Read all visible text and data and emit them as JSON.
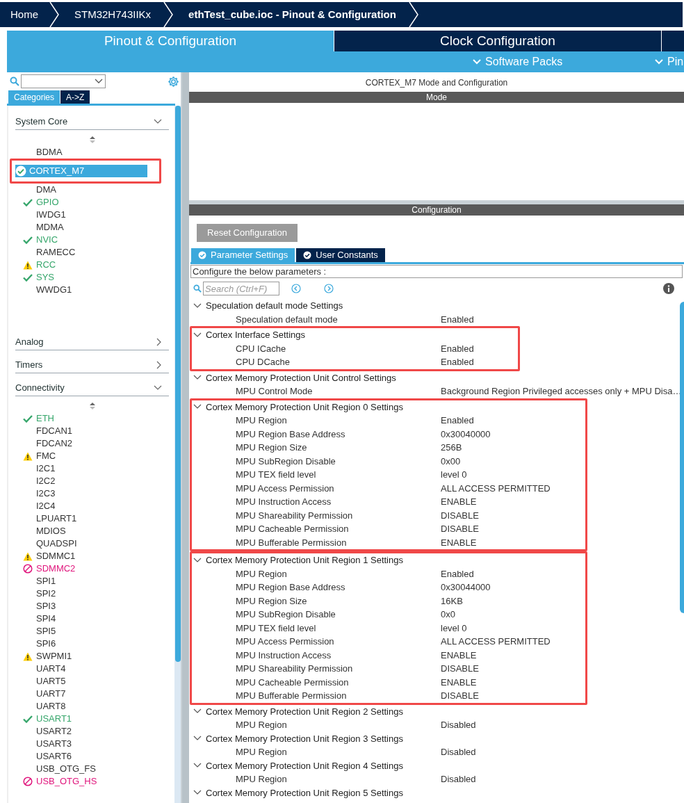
{
  "breadcrumbs": [
    "Home",
    "STM32H743IIKx",
    "ethTest_cube.ioc - Pinout & Configuration"
  ],
  "main_tabs": [
    {
      "label": "Pinout & Configuration",
      "selected": true
    },
    {
      "label": "Clock Configuration",
      "selected": false
    }
  ],
  "sub_menu": [
    "Software Packs",
    "Pin"
  ],
  "sidebar": {
    "tabs": [
      {
        "label": "Categories",
        "selected": true
      },
      {
        "label": "A->Z",
        "selected": false
      }
    ],
    "categories": [
      {
        "label": "System Core",
        "expanded": true,
        "items": [
          {
            "label": "BDMA",
            "kind": "plain",
            "configured": false,
            "selected": false
          },
          {
            "label": "CORTEX_M7",
            "kind": "check",
            "configured": true,
            "selected": true,
            "highlighted": true
          },
          {
            "label": "DMA",
            "kind": "plain",
            "configured": false,
            "selected": false
          },
          {
            "label": "GPIO",
            "kind": "check",
            "configured": true,
            "selected": false
          },
          {
            "label": "IWDG1",
            "kind": "plain",
            "configured": false,
            "selected": false
          },
          {
            "label": "MDMA",
            "kind": "plain",
            "configured": false,
            "selected": false
          },
          {
            "label": "NVIC",
            "kind": "check",
            "configured": true,
            "selected": false
          },
          {
            "label": "RAMECC",
            "kind": "plain",
            "configured": false,
            "selected": false
          },
          {
            "label": "RCC",
            "kind": "warning",
            "configured": true,
            "selected": false
          },
          {
            "label": "SYS",
            "kind": "check",
            "configured": true,
            "selected": false
          },
          {
            "label": "WWDG1",
            "kind": "plain",
            "configured": false,
            "selected": false
          }
        ]
      },
      {
        "label": "Analog",
        "expanded": false
      },
      {
        "label": "Timers",
        "expanded": false
      },
      {
        "label": "Connectivity",
        "expanded": true,
        "items": [
          {
            "label": "ETH",
            "kind": "check",
            "configured": true,
            "selected": false
          },
          {
            "label": "FDCAN1",
            "kind": "plain",
            "configured": false,
            "selected": false
          },
          {
            "label": "FDCAN2",
            "kind": "plain",
            "configured": false,
            "selected": false
          },
          {
            "label": "FMC",
            "kind": "warning",
            "configured": false,
            "selected": false
          },
          {
            "label": "I2C1",
            "kind": "plain",
            "configured": false,
            "selected": false
          },
          {
            "label": "I2C2",
            "kind": "plain",
            "configured": false,
            "selected": false
          },
          {
            "label": "I2C3",
            "kind": "plain",
            "configured": false,
            "selected": false
          },
          {
            "label": "I2C4",
            "kind": "plain",
            "configured": false,
            "selected": false
          },
          {
            "label": "LPUART1",
            "kind": "plain",
            "configured": false,
            "selected": false
          },
          {
            "label": "MDIOS",
            "kind": "plain",
            "configured": false,
            "selected": false
          },
          {
            "label": "QUADSPI",
            "kind": "plain",
            "configured": false,
            "selected": false
          },
          {
            "label": "SDMMC1",
            "kind": "warning",
            "configured": false,
            "selected": false
          },
          {
            "label": "SDMMC2",
            "kind": "blocked",
            "configured": false,
            "selected": false
          },
          {
            "label": "SPI1",
            "kind": "plain",
            "configured": false,
            "selected": false
          },
          {
            "label": "SPI2",
            "kind": "plain",
            "configured": false,
            "selected": false
          },
          {
            "label": "SPI3",
            "kind": "plain",
            "configured": false,
            "selected": false
          },
          {
            "label": "SPI4",
            "kind": "plain",
            "configured": false,
            "selected": false
          },
          {
            "label": "SPI5",
            "kind": "plain",
            "configured": false,
            "selected": false
          },
          {
            "label": "SPI6",
            "kind": "plain",
            "configured": false,
            "selected": false
          },
          {
            "label": "SWPMI1",
            "kind": "warning",
            "configured": false,
            "selected": false
          },
          {
            "label": "UART4",
            "kind": "plain",
            "configured": false,
            "selected": false
          },
          {
            "label": "UART5",
            "kind": "plain",
            "configured": false,
            "selected": false
          },
          {
            "label": "UART7",
            "kind": "plain",
            "configured": false,
            "selected": false
          },
          {
            "label": "UART8",
            "kind": "plain",
            "configured": false,
            "selected": false
          },
          {
            "label": "USART1",
            "kind": "check",
            "configured": true,
            "selected": false
          },
          {
            "label": "USART2",
            "kind": "plain",
            "configured": false,
            "selected": false
          },
          {
            "label": "USART3",
            "kind": "plain",
            "configured": false,
            "selected": false
          },
          {
            "label": "USART6",
            "kind": "plain",
            "configured": false,
            "selected": false
          },
          {
            "label": "USB_OTG_FS",
            "kind": "plain",
            "configured": false,
            "selected": false
          },
          {
            "label": "USB_OTG_HS",
            "kind": "blocked",
            "configured": false,
            "selected": false
          }
        ]
      }
    ]
  },
  "panel_title": "CORTEX_M7 Mode and Configuration",
  "mode_header": "Mode",
  "config_header": "Configuration",
  "reset_button": "Reset Configuration",
  "config_tabs": [
    {
      "label": "Parameter Settings",
      "selected": true
    },
    {
      "label": "User Constants",
      "selected": false
    }
  ],
  "instructions": "Configure the below parameters :",
  "search": {
    "placeholder": "Search (Ctrl+F)"
  },
  "groups": [
    {
      "title": "Speculation default mode Settings",
      "expanded": true,
      "highlighted": false,
      "params": [
        {
          "name": "Speculation default mode",
          "value": "Enabled"
        }
      ]
    },
    {
      "title": "Cortex Interface Settings",
      "expanded": true,
      "highlighted": true,
      "params": [
        {
          "name": "CPU ICache",
          "value": "Enabled"
        },
        {
          "name": "CPU DCache",
          "value": "Enabled"
        }
      ]
    },
    {
      "title": "Cortex Memory Protection Unit Control Settings",
      "expanded": true,
      "highlighted": false,
      "params": [
        {
          "name": "MPU Control Mode",
          "value": "Background Region Privileged accesses only + MPU Disa…"
        }
      ]
    },
    {
      "title": "Cortex Memory Protection Unit Region 0 Settings",
      "expanded": true,
      "highlighted": true,
      "params": [
        {
          "name": "MPU Region",
          "value": "Enabled"
        },
        {
          "name": "MPU Region Base Address",
          "value": "0x30040000"
        },
        {
          "name": "MPU Region Size",
          "value": "256B"
        },
        {
          "name": "MPU SubRegion Disable",
          "value": "0x00"
        },
        {
          "name": "MPU TEX field level",
          "value": "level 0"
        },
        {
          "name": "MPU Access Permission",
          "value": "ALL ACCESS PERMITTED"
        },
        {
          "name": "MPU Instruction Access",
          "value": "ENABLE"
        },
        {
          "name": "MPU Shareability Permission",
          "value": "DISABLE"
        },
        {
          "name": "MPU Cacheable Permission",
          "value": "DISABLE"
        },
        {
          "name": "MPU Bufferable  Permission",
          "value": "ENABLE"
        }
      ]
    },
    {
      "title": "Cortex Memory Protection Unit Region 1 Settings",
      "expanded": true,
      "highlighted": true,
      "params": [
        {
          "name": "MPU Region",
          "value": "Enabled"
        },
        {
          "name": "MPU Region Base Address",
          "value": "0x30044000"
        },
        {
          "name": "MPU Region Size",
          "value": "16KB"
        },
        {
          "name": "MPU SubRegion Disable",
          "value": "0x0"
        },
        {
          "name": "MPU TEX field level",
          "value": "level 0"
        },
        {
          "name": "MPU Access Permission",
          "value": "ALL ACCESS PERMITTED"
        },
        {
          "name": "MPU Instruction Access",
          "value": "ENABLE"
        },
        {
          "name": "MPU Shareability Permission",
          "value": "DISABLE"
        },
        {
          "name": "MPU Cacheable Permission",
          "value": "ENABLE"
        },
        {
          "name": "MPU Bufferable  Permission",
          "value": "DISABLE"
        }
      ]
    },
    {
      "title": "Cortex Memory Protection Unit Region 2 Settings",
      "expanded": true,
      "highlighted": false,
      "params": [
        {
          "name": "MPU Region",
          "value": "Disabled"
        }
      ]
    },
    {
      "title": "Cortex Memory Protection Unit Region 3 Settings",
      "expanded": true,
      "highlighted": false,
      "params": [
        {
          "name": "MPU Region",
          "value": "Disabled"
        }
      ]
    },
    {
      "title": "Cortex Memory Protection Unit Region 4 Settings",
      "expanded": true,
      "highlighted": false,
      "params": [
        {
          "name": "MPU Region",
          "value": "Disabled"
        }
      ]
    },
    {
      "title": "Cortex Memory Protection Unit Region 5 Settings",
      "expanded": true,
      "highlighted": false
    }
  ]
}
